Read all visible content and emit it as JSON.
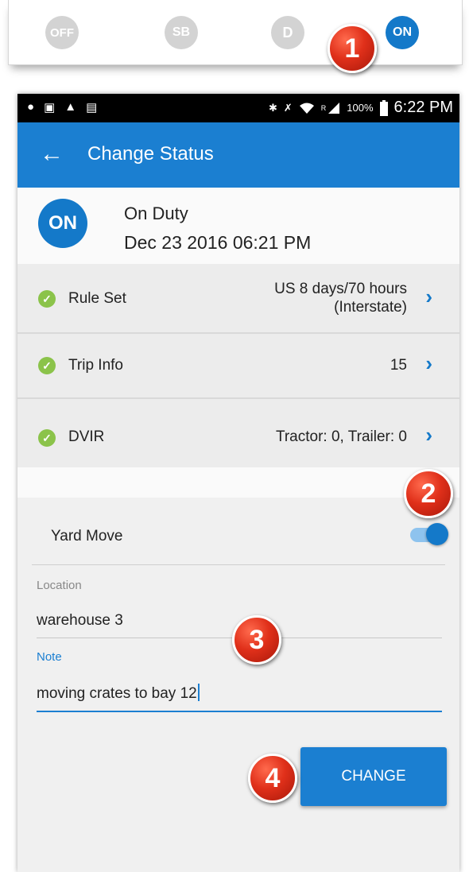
{
  "duty_strip": {
    "off_label": "OFF",
    "sb_label": "SB",
    "d_label": "D",
    "on_label": "ON"
  },
  "callouts": [
    "1",
    "2",
    "3",
    "4"
  ],
  "status_bar": {
    "left_icons": [
      "notification-icon",
      "image-icon",
      "warning-icon",
      "clipboard-icon"
    ],
    "right_icons": [
      "bluetooth-icon",
      "mute-icon",
      "wifi-icon",
      "signal-icon",
      "battery-icon"
    ],
    "roaming": "R",
    "battery": "100%",
    "time": "6:22 PM"
  },
  "app_bar": {
    "title": "Change Status"
  },
  "current_status": {
    "badge": "ON",
    "status": "On Duty",
    "datetime": "Dec 23 2016 06:21 PM"
  },
  "rows": [
    {
      "label": "Rule Set",
      "value_line1": "US 8 days/70 hours",
      "value_line2": "(Interstate)"
    },
    {
      "label": "Trip Info",
      "value": "15"
    },
    {
      "label": "DVIR",
      "value": "Tractor: 0, Trailer: 0"
    }
  ],
  "yard_move": {
    "label": "Yard Move",
    "enabled": true
  },
  "location": {
    "label": "Location",
    "value": "warehouse 3"
  },
  "note": {
    "label": "Note",
    "value": "moving crates to bay 12"
  },
  "change_button": "CHANGE",
  "colors": {
    "accent": "#1b7fd1",
    "check": "#8bc34a",
    "inactive_status": "#d3d3d3",
    "callout": "#e0301a"
  }
}
